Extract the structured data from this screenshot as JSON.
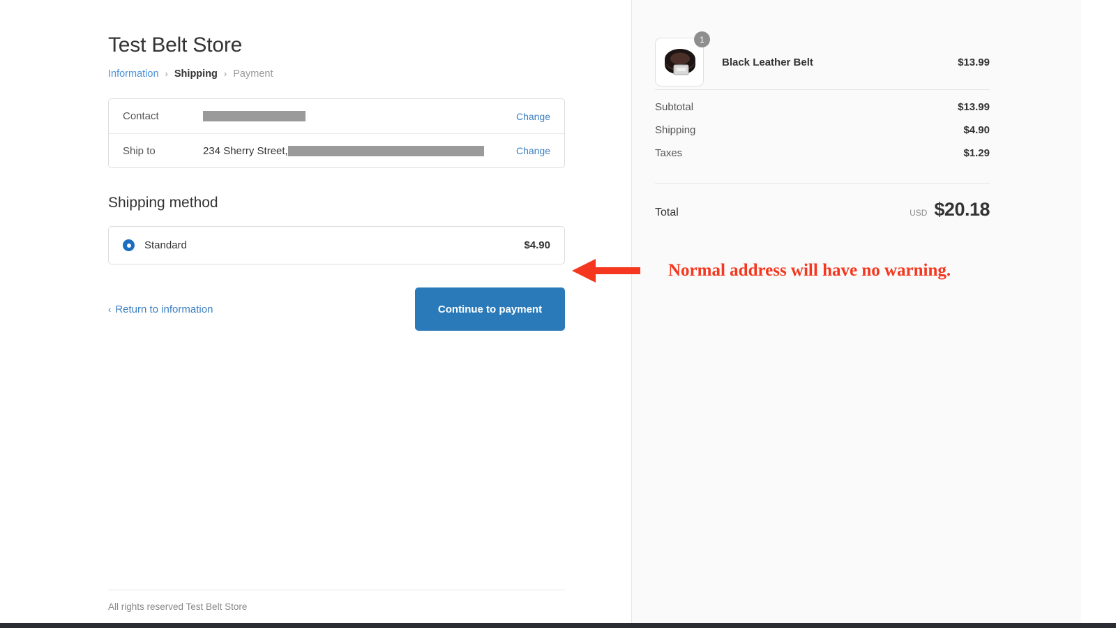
{
  "store": {
    "title": "Test Belt Store",
    "footer_text": "All rights reserved Test Belt Store"
  },
  "breadcrumb": {
    "information": "Information",
    "shipping": "Shipping",
    "payment": "Payment",
    "separator": "›"
  },
  "review": {
    "contact_label": "Contact",
    "contact_value_redacted": "",
    "ship_to_label": "Ship to",
    "ship_to_value": "234 Sherry Street,",
    "change_label": "Change"
  },
  "shipping_method": {
    "heading": "Shipping method",
    "option_name": "Standard",
    "option_price": "$4.90",
    "selected": true
  },
  "actions": {
    "return_label": "Return to information",
    "return_chevron": "‹",
    "continue_label": "Continue to payment",
    "continue_color": "#2a7ab9"
  },
  "summary": {
    "item": {
      "name": "Black Leather Belt",
      "price": "$13.99",
      "quantity": "1"
    },
    "lines": [
      {
        "label": "Subtotal",
        "value": "$13.99"
      },
      {
        "label": "Shipping",
        "value": "$4.90"
      },
      {
        "label": "Taxes",
        "value": "$1.29"
      }
    ],
    "total": {
      "label": "Total",
      "currency": "USD",
      "amount": "$20.18"
    }
  },
  "annotation": {
    "text": "Normal address will have no warning.",
    "color": "#f4371e"
  }
}
